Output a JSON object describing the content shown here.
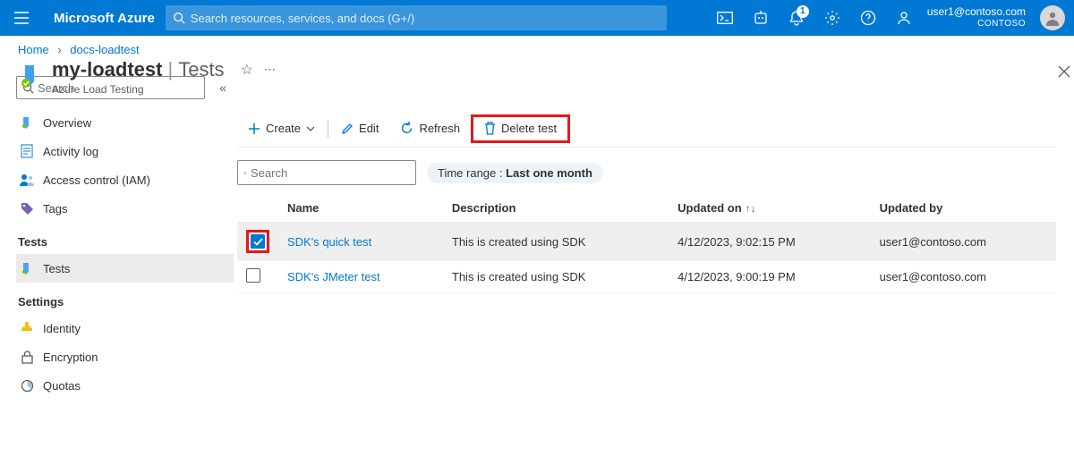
{
  "header": {
    "brand": "Microsoft Azure",
    "search_placeholder": "Search resources, services, and docs (G+/)",
    "notification_count": "1",
    "account_email": "user1@contoso.com",
    "account_tenant": "CONTOSO"
  },
  "breadcrumb": {
    "home": "Home",
    "resource": "docs-loadtest"
  },
  "resource": {
    "name": "my-loadtest",
    "section": "Tests",
    "provider": "Azure Load Testing"
  },
  "nav": {
    "search_placeholder": "Search",
    "items_top": [
      {
        "label": "Overview",
        "icon": "overview"
      },
      {
        "label": "Activity log",
        "icon": "activity"
      },
      {
        "label": "Access control (IAM)",
        "icon": "iam"
      },
      {
        "label": "Tags",
        "icon": "tags"
      }
    ],
    "group_tests": "Tests",
    "items_tests": [
      {
        "label": "Tests",
        "icon": "tests",
        "selected": true
      }
    ],
    "group_settings": "Settings",
    "items_settings": [
      {
        "label": "Identity",
        "icon": "identity"
      },
      {
        "label": "Encryption",
        "icon": "encryption"
      },
      {
        "label": "Quotas",
        "icon": "quotas"
      }
    ]
  },
  "toolbar": {
    "create": "Create",
    "edit": "Edit",
    "refresh": "Refresh",
    "delete": "Delete test"
  },
  "filters": {
    "list_search_placeholder": "Search",
    "time_range_label": "Time range : ",
    "time_range_value": "Last one month"
  },
  "table": {
    "cols": {
      "name": "Name",
      "description": "Description",
      "updated_on": "Updated on",
      "updated_by": "Updated by"
    },
    "rows": [
      {
        "selected": true,
        "name": "SDK's quick test",
        "description": "This is created using SDK",
        "updated_on": "4/12/2023, 9:02:15 PM",
        "updated_by": "user1@contoso.com"
      },
      {
        "selected": false,
        "name": "SDK's JMeter test",
        "description": "This is created using SDK",
        "updated_on": "4/12/2023, 9:00:19 PM",
        "updated_by": "user1@contoso.com"
      }
    ]
  }
}
